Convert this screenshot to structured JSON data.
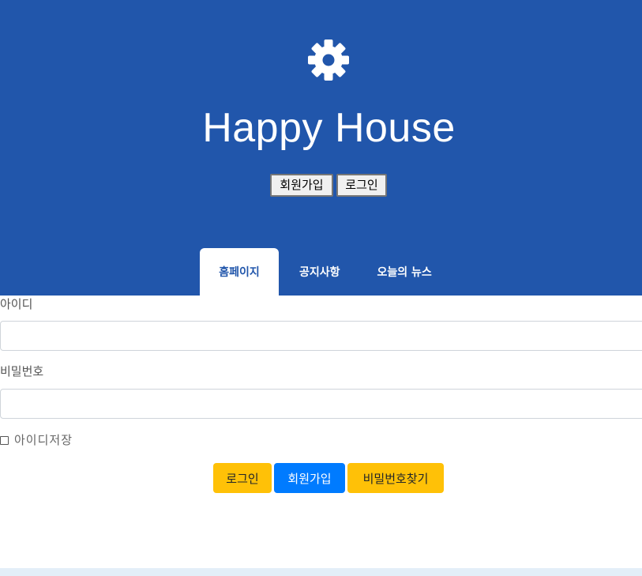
{
  "header": {
    "logo_icon": "gear-icon",
    "title": "Happy House",
    "background_color": "#2156ab",
    "signup_button": "회원가입",
    "login_button": "로그인"
  },
  "nav": {
    "tabs": [
      {
        "label": "홈페이지",
        "active": true
      },
      {
        "label": "공지사항",
        "active": false
      },
      {
        "label": "오늘의 뉴스",
        "active": false
      }
    ]
  },
  "login_form": {
    "id_label": "아이디",
    "id_value": "",
    "password_label": "비밀번호",
    "password_value": "",
    "remember_label": "아이디저장",
    "remember_checked": false,
    "login_button": "로그인",
    "signup_button": "회원가입",
    "find_password_button": "비밀번호찾기",
    "colors": {
      "yellow": "#ffc107",
      "blue": "#007bff"
    }
  }
}
